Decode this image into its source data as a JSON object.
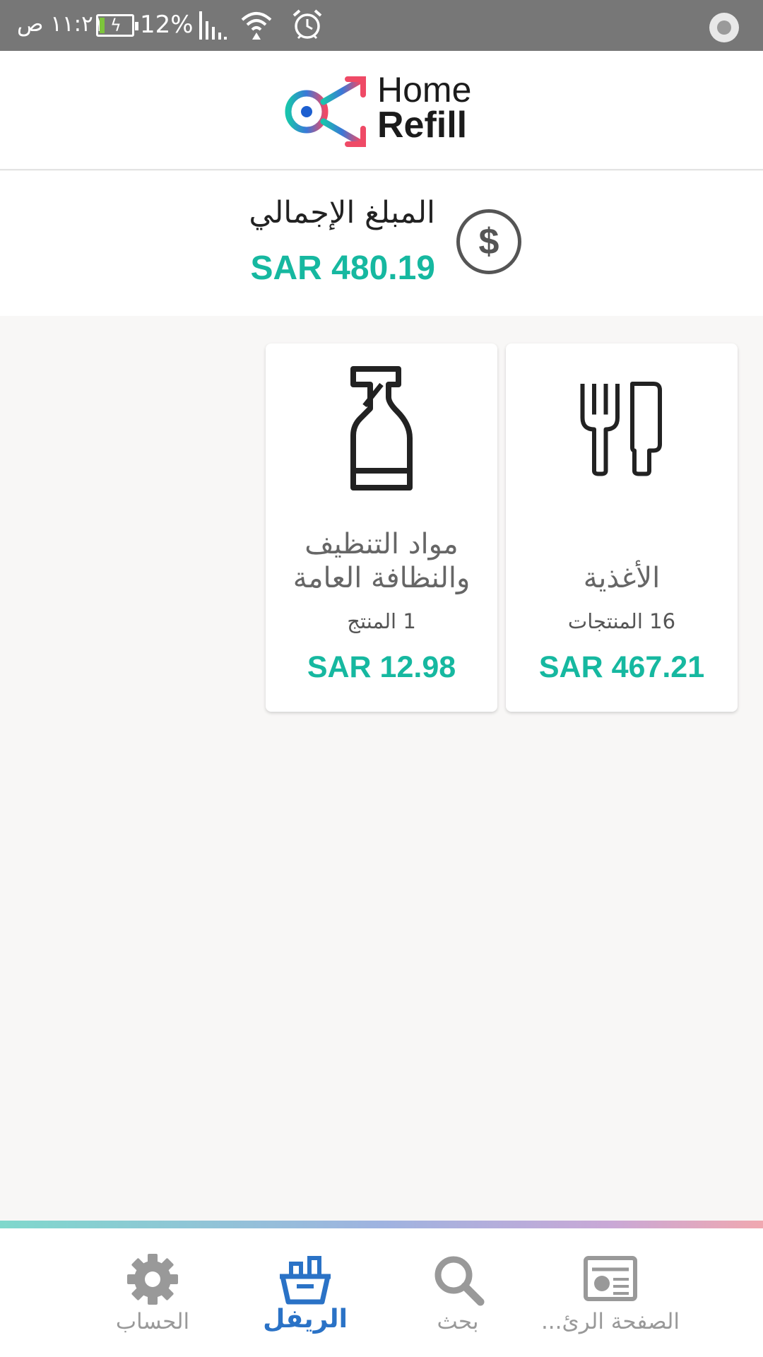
{
  "status_bar": {
    "time": "١١:٢١ ص",
    "battery_percent": "12%",
    "battery_level": 0.12
  },
  "header": {
    "logo_line1": "Home",
    "logo_line2": "Refill"
  },
  "total": {
    "label": "المبلغ الإجمالي",
    "amount": "SAR 480.19",
    "icon": "dollar-icon"
  },
  "categories": [
    {
      "title": "الأغذية",
      "count": "16 المنتجات",
      "price": "SAR 467.21",
      "icon": "fork-knife-icon"
    },
    {
      "title": "مواد التنظيف والنظافة العامة",
      "count": "1 المنتج",
      "price": "SAR 12.98",
      "icon": "spray-bottle-icon"
    }
  ],
  "nav": {
    "items": [
      {
        "label": "الصفحة الرئ...",
        "icon": "newspaper-icon",
        "active": false
      },
      {
        "label": "بحث",
        "icon": "search-icon",
        "active": false
      },
      {
        "label": "الريفل",
        "icon": "basket-icon",
        "active": true
      },
      {
        "label": "الحساب",
        "icon": "gear-icon",
        "active": false
      }
    ]
  },
  "colors": {
    "accent_teal": "#16b8a0",
    "active_blue": "#2a72c6",
    "status_bar": "#777777"
  }
}
